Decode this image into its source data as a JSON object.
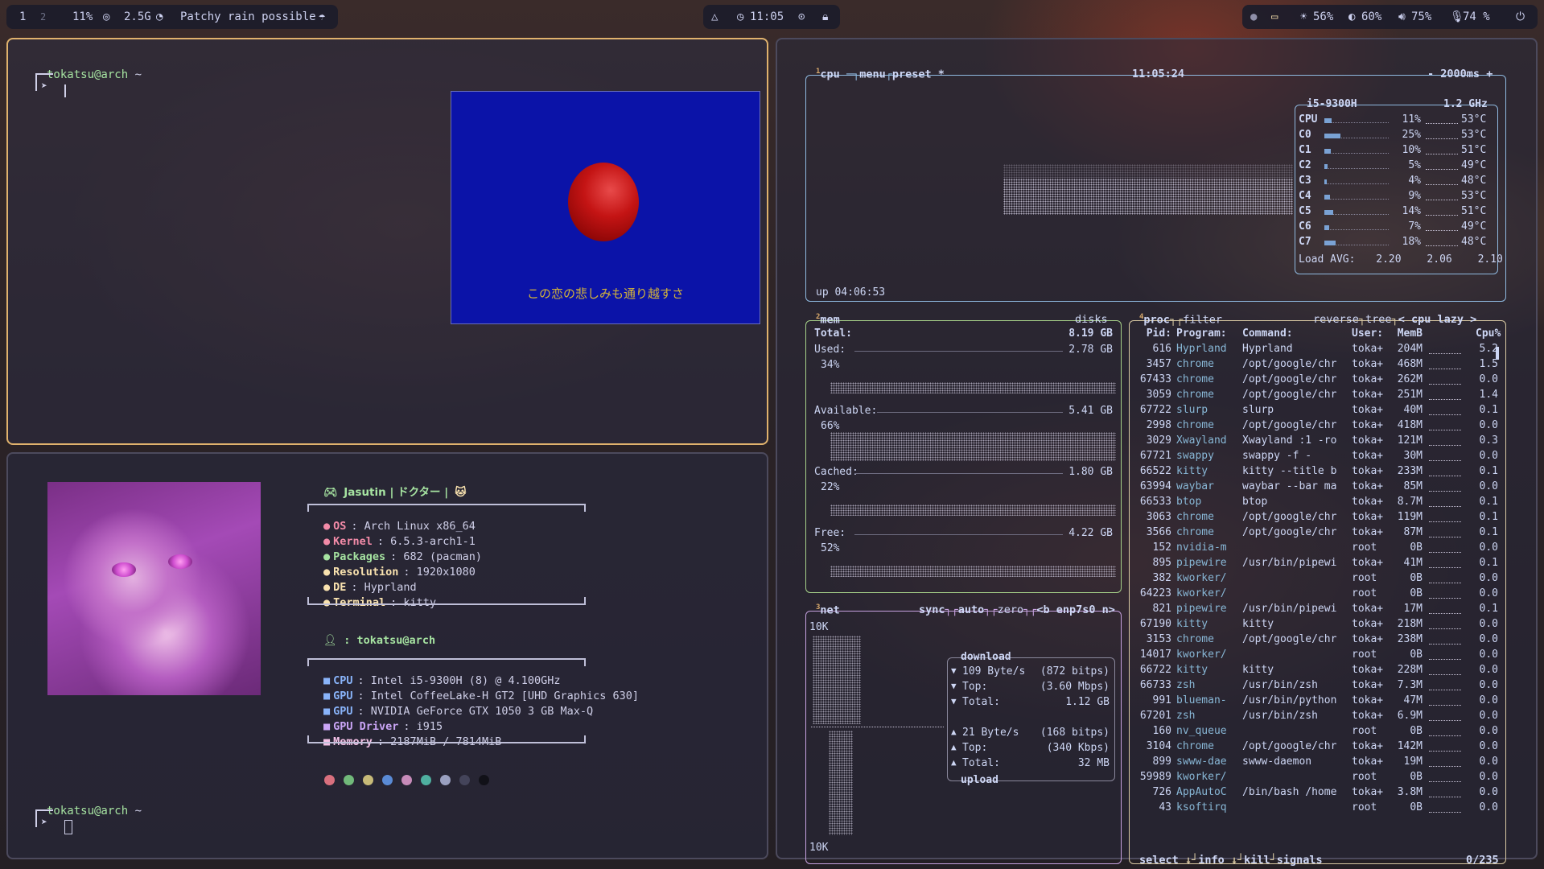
{
  "topbar": {
    "workspaces": [
      "1",
      "2"
    ],
    "cpu": "11%",
    "memory": "2.5G",
    "weather": "Patchy rain possible",
    "time": "11:05",
    "brightness_screen": "56%",
    "brightness_kb": "60%",
    "volume": "75%",
    "mic": "74 %"
  },
  "term1": {
    "user": "tokatsu@arch",
    "path": "~",
    "game_text": "この恋の悲しみも通り越すさ"
  },
  "term2": {
    "user": "tokatsu@arch",
    "path": "~",
    "header": "Jasutin | ドクター |",
    "info": [
      {
        "key": "OS",
        "value": ": Arch Linux x86_64",
        "color": "#f38ba8"
      },
      {
        "key": "Kernel",
        "value": ": 6.5.3-arch1-1",
        "color": "#f38ba8"
      },
      {
        "key": "Packages",
        "value": ": 682 (pacman)",
        "color": "#a6e3a1"
      },
      {
        "key": "Resolution",
        "value": ": 1920x1080",
        "color": "#f9e2af"
      },
      {
        "key": "DE",
        "value": ": Hyprland",
        "color": "#f9e2af"
      },
      {
        "key": "Terminal",
        "value": ": kitty",
        "color": "#f9e2af"
      }
    ],
    "user_line": ": tokatsu@arch",
    "hw": [
      {
        "key": "CPU",
        "value": ": Intel i5-9300H (8) @ 4.100GHz",
        "color": "#89b4fa"
      },
      {
        "key": "GPU",
        "value": ": Intel CoffeeLake-H GT2 [UHD Graphics 630]",
        "color": "#89b4fa"
      },
      {
        "key": "GPU",
        "value": ": NVIDIA GeForce GTX 1050 3 GB Max-Q",
        "color": "#89b4fa"
      },
      {
        "key": "GPU Driver",
        "value": ": i915",
        "color": "#cba6f7"
      },
      {
        "key": "Memory",
        "value": ": 2187MiB / 7814MiB",
        "color": "#f5c2e7"
      }
    ],
    "palette": [
      "#d9707e",
      "#71b97a",
      "#c7ba78",
      "#5a8bd6",
      "#c78bb9",
      "#4fb0a0",
      "#9aa0c0",
      "#44445a",
      "#111118"
    ]
  },
  "btop": {
    "cpu_box": {
      "tab_num": "1",
      "tabs": [
        "cpu",
        "menu",
        "preset *"
      ],
      "clock": "11:05:24",
      "interval": "2000ms",
      "minus": "-",
      "plus": "+",
      "uptime": "up 04:06:53",
      "model": "i5-9300H",
      "freq": "1.2 GHz",
      "cores": [
        {
          "name": "CPU",
          "pct": "11%",
          "temp": "53°C"
        },
        {
          "name": "C0",
          "pct": "25%",
          "temp": "53°C"
        },
        {
          "name": "C1",
          "pct": "10%",
          "temp": "51°C"
        },
        {
          "name": "C2",
          "pct": "5%",
          "temp": "49°C"
        },
        {
          "name": "C3",
          "pct": "4%",
          "temp": "48°C"
        },
        {
          "name": "C4",
          "pct": "9%",
          "temp": "53°C"
        },
        {
          "name": "C5",
          "pct": "14%",
          "temp": "51°C"
        },
        {
          "name": "C6",
          "pct": "7%",
          "temp": "49°C"
        },
        {
          "name": "C7",
          "pct": "18%",
          "temp": "48°C"
        }
      ],
      "load_label": "Load AVG:",
      "load": [
        "2.20",
        "2.06",
        "2.10"
      ]
    },
    "mem_box": {
      "tab_num": "2",
      "title": "mem",
      "disks": "disks",
      "total_label": "Total:",
      "total": "8.19 GB",
      "rows": [
        {
          "label": "Used:",
          "value": "2.78 GB",
          "pct": "34%"
        },
        {
          "label": "Available:",
          "value": "5.41 GB",
          "pct": "66%"
        },
        {
          "label": "Cached:",
          "value": "1.80 GB",
          "pct": "22%"
        },
        {
          "label": "Free:",
          "value": "4.22 GB",
          "pct": "52%"
        }
      ]
    },
    "net_box": {
      "tab_num": "3",
      "title": "net",
      "tabs": [
        "sync",
        "auto",
        "zero"
      ],
      "iface_prev": "<b",
      "iface": "enp7s0",
      "iface_next": "n>",
      "scale_top": "10K",
      "scale_bottom": "10K",
      "download_title": "download",
      "upload_title": "upload",
      "down": [
        {
          "arrow": "▼",
          "label": "109 Byte/s",
          "value": "(872 bitps)"
        },
        {
          "arrow": "▼",
          "label": "Top:",
          "value": "(3.60 Mbps)"
        },
        {
          "arrow": "▼",
          "label": "Total:",
          "value": "1.12 GB"
        }
      ],
      "up": [
        {
          "arrow": "▲",
          "label": "21 Byte/s",
          "value": "(168 bitps)"
        },
        {
          "arrow": "▲",
          "label": "Top:",
          "value": "(340 Kbps)"
        },
        {
          "arrow": "▲",
          "label": "Total:",
          "value": "32 MB"
        }
      ]
    },
    "proc_box": {
      "tab_num": "4",
      "title": "proc",
      "filter": "filter",
      "reverse": "reverse",
      "tree": "tree",
      "sort": "< cpu lazy >",
      "headers": [
        "Pid:",
        "Program:",
        "Command:",
        "User:",
        "MemB",
        "Cpu%"
      ],
      "rows": [
        [
          "616",
          "Hyprland",
          "Hyprland",
          "toka+",
          "204M",
          "5.2"
        ],
        [
          "3457",
          "chrome",
          "/opt/google/chr",
          "toka+",
          "468M",
          "1.5"
        ],
        [
          "67433",
          "chrome",
          "/opt/google/chr",
          "toka+",
          "262M",
          "0.0"
        ],
        [
          "3059",
          "chrome",
          "/opt/google/chr",
          "toka+",
          "251M",
          "1.4"
        ],
        [
          "67722",
          "slurp",
          "slurp",
          "toka+",
          "40M",
          "0.1"
        ],
        [
          "2998",
          "chrome",
          "/opt/google/chr",
          "toka+",
          "418M",
          "0.0"
        ],
        [
          "3029",
          "Xwayland",
          "Xwayland :1 -ro",
          "toka+",
          "121M",
          "0.3"
        ],
        [
          "67721",
          "swappy",
          "swappy -f -",
          "toka+",
          "30M",
          "0.0"
        ],
        [
          "66522",
          "kitty",
          "kitty --title b",
          "toka+",
          "233M",
          "0.1"
        ],
        [
          "63994",
          "waybar",
          "waybar --bar ma",
          "toka+",
          "85M",
          "0.0"
        ],
        [
          "66533",
          "btop",
          "btop",
          "toka+",
          "8.7M",
          "0.1"
        ],
        [
          "3063",
          "chrome",
          "/opt/google/chr",
          "toka+",
          "119M",
          "0.1"
        ],
        [
          "3566",
          "chrome",
          "/opt/google/chr",
          "toka+",
          "87M",
          "0.1"
        ],
        [
          "152",
          "nvidia-m",
          "",
          "root",
          "0B",
          "0.0"
        ],
        [
          "895",
          "pipewire",
          "/usr/bin/pipewi",
          "toka+",
          "41M",
          "0.1"
        ],
        [
          "382",
          "kworker/",
          "",
          "root",
          "0B",
          "0.0"
        ],
        [
          "64223",
          "kworker/",
          "",
          "root",
          "0B",
          "0.0"
        ],
        [
          "821",
          "pipewire",
          "/usr/bin/pipewi",
          "toka+",
          "17M",
          "0.1"
        ],
        [
          "67190",
          "kitty",
          "kitty",
          "toka+",
          "218M",
          "0.0"
        ],
        [
          "3153",
          "chrome",
          "/opt/google/chr",
          "toka+",
          "238M",
          "0.0"
        ],
        [
          "14017",
          "kworker/",
          "",
          "root",
          "0B",
          "0.0"
        ],
        [
          "66722",
          "kitty",
          "kitty",
          "toka+",
          "228M",
          "0.0"
        ],
        [
          "66733",
          "zsh",
          "/usr/bin/zsh",
          "toka+",
          "7.3M",
          "0.0"
        ],
        [
          "991",
          "blueman-",
          "/usr/bin/python",
          "toka+",
          "47M",
          "0.0"
        ],
        [
          "67201",
          "zsh",
          "/usr/bin/zsh",
          "toka+",
          "6.9M",
          "0.0"
        ],
        [
          "160",
          "nv_queue",
          "",
          "root",
          "0B",
          "0.0"
        ],
        [
          "3104",
          "chrome",
          "/opt/google/chr",
          "toka+",
          "142M",
          "0.0"
        ],
        [
          "899",
          "swww-dae",
          "swww-daemon",
          "toka+",
          "19M",
          "0.0"
        ],
        [
          "59989",
          "kworker/",
          "",
          "root",
          "0B",
          "0.0"
        ],
        [
          "726",
          "AppAutoC",
          "/bin/bash /home",
          "toka+",
          "3.8M",
          "0.0"
        ],
        [
          "43",
          "ksoftirq",
          "",
          "root",
          "0B",
          "0.0"
        ]
      ],
      "footer": {
        "select": "select",
        "info": "info",
        "kill": "kill",
        "signals": "signals",
        "count": "0/235"
      }
    }
  }
}
